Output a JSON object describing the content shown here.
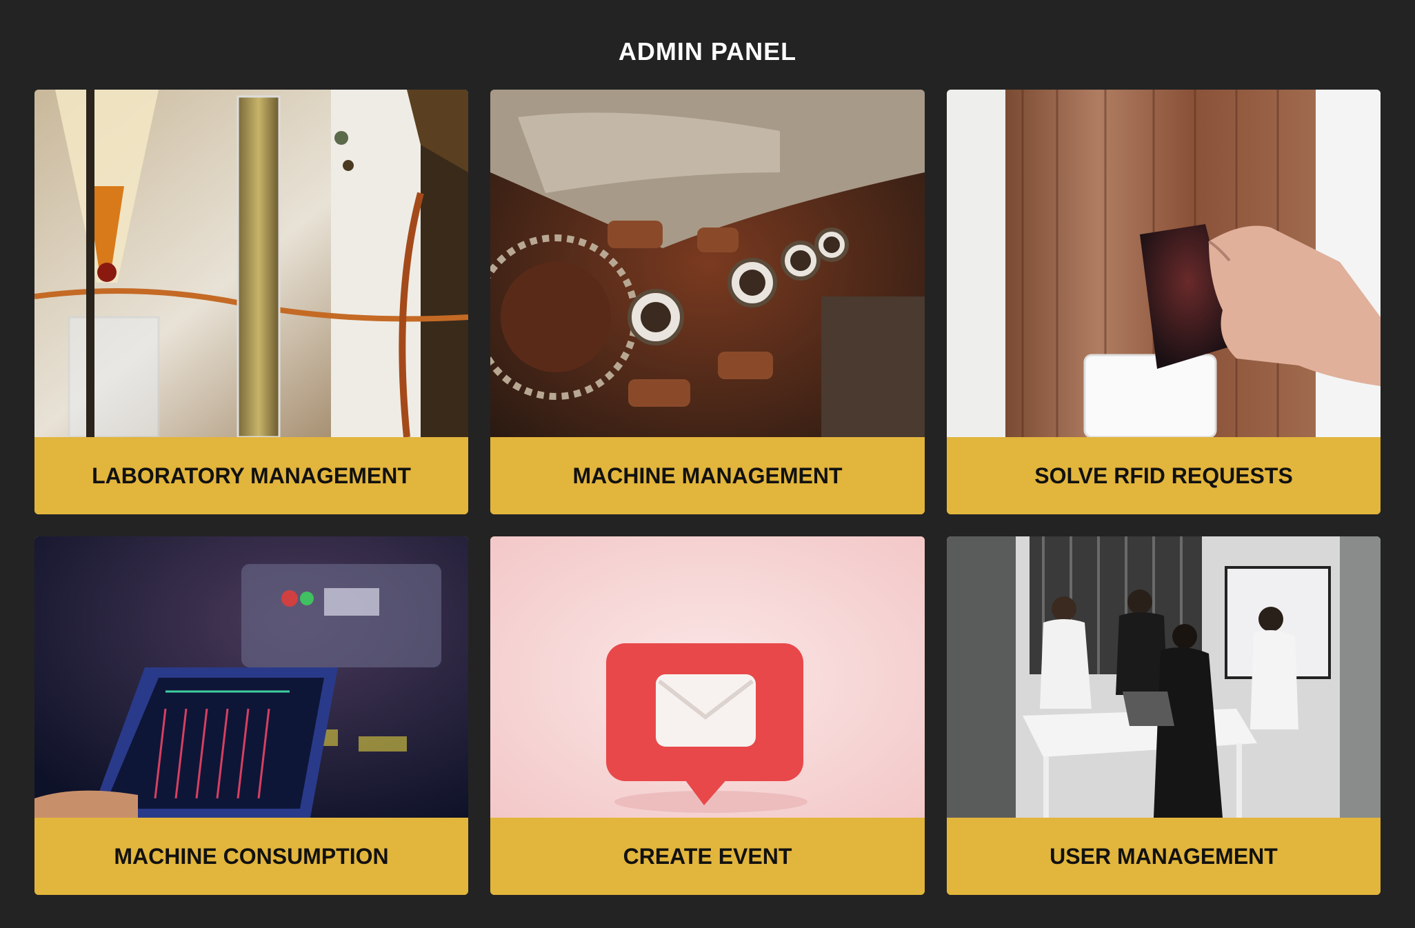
{
  "page": {
    "title": "ADMIN PANEL"
  },
  "colors": {
    "background": "#232323",
    "card_label_bg": "#e2b53c",
    "title_text": "#ffffff",
    "label_text": "#111111"
  },
  "cards": [
    {
      "label": "LABORATORY MANAGEMENT",
      "image": "laboratory-glassware-photo"
    },
    {
      "label": "MACHINE MANAGEMENT",
      "image": "engine-gears-photo"
    },
    {
      "label": "SOLVE RFID REQUESTS",
      "image": "rfid-keycard-photo"
    },
    {
      "label": "MACHINE CONSUMPTION",
      "image": "audio-mixer-tablet-photo"
    },
    {
      "label": "CREATE EVENT",
      "image": "message-envelope-icon"
    },
    {
      "label": "USER MANAGEMENT",
      "image": "team-meeting-photo"
    }
  ]
}
